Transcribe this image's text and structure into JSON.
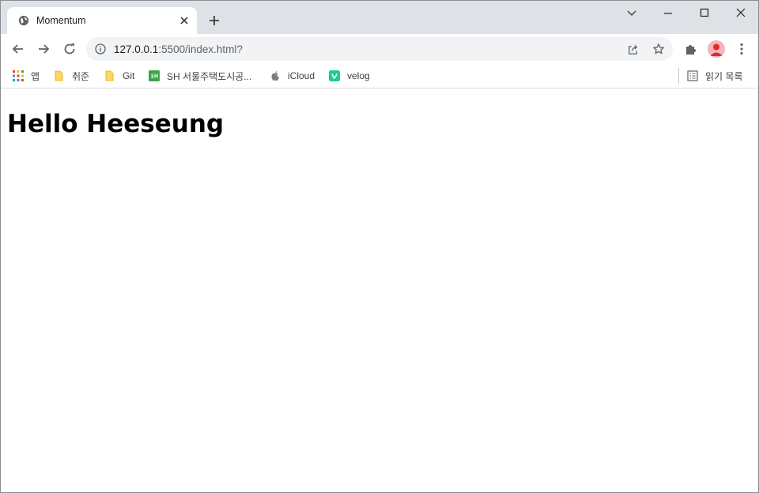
{
  "browser": {
    "tab": {
      "title": "Momentum"
    },
    "omnibox": {
      "url_host": "127.0.0.1",
      "url_path": ":5500/index.html?"
    }
  },
  "bookmarks": [
    {
      "label": "앱",
      "icon": "apps-grid-icon"
    },
    {
      "label": "취준",
      "icon": "folder-icon"
    },
    {
      "label": "Git",
      "icon": "folder-icon"
    },
    {
      "label": "SH 서울주택도시공...",
      "icon": "sh-logo-icon"
    },
    {
      "label": "iCloud",
      "icon": "apple-icon"
    },
    {
      "label": "velog",
      "icon": "velog-icon"
    }
  ],
  "reading_list": {
    "label": "읽기 목록",
    "icon": "reading-list-icon"
  },
  "page": {
    "heading": "Hello Heeseung"
  },
  "colors": {
    "tabstrip_bg": "#dee1e6",
    "omnibox_bg": "#f1f3f4",
    "folder": "#fdd663",
    "sh_green": "#3fa34d",
    "velog_green": "#20c997",
    "avatar_bg": "#f6b3bf"
  }
}
